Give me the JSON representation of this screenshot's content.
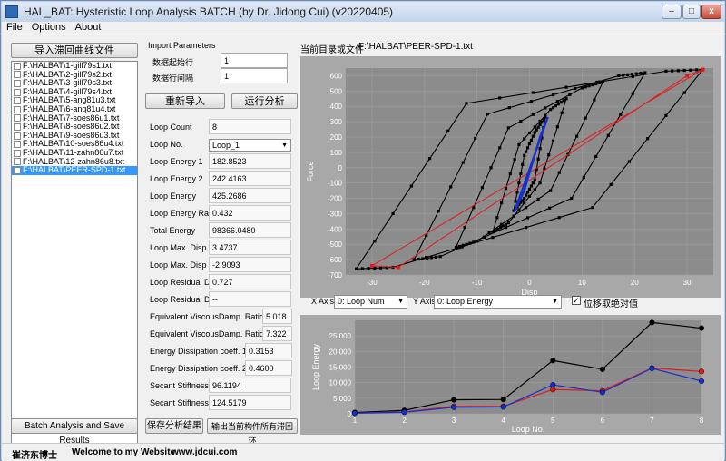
{
  "window": {
    "title": "HAL_BAT: Hysteristic Loop Analysis BATCH (by Dr. Jidong Cui) (v20220405)",
    "min": "–",
    "max": "□",
    "close": "x"
  },
  "menu": [
    "File",
    "Options",
    "About"
  ],
  "left": {
    "import_button": "导入滞回曲线文件",
    "files": [
      "F:\\HALBAT\\1-gill79s1.txt",
      "F:\\HALBAT\\2-gill79s2.txt",
      "F:\\HALBAT\\3-gill79s3.txt",
      "F:\\HALBAT\\4-gill79s4.txt",
      "F:\\HALBAT\\5-ang81u3.txt",
      "F:\\HALBAT\\6-ang81u4.txt",
      "F:\\HALBAT\\7-soes86u1.txt",
      "F:\\HALBAT\\8-soes86u2.txt",
      "F:\\HALBAT\\9-soes86u3.txt",
      "F:\\HALBAT\\10-soes86u4.txt",
      "F:\\HALBAT\\11-zahn86u7.txt",
      "F:\\HALBAT\\12-zahn86u8.txt",
      "F:\\HALBAT\\PEER-SPD-1.txt"
    ],
    "batch_button": "Batch Analysis and Save Results"
  },
  "params": {
    "group_title": "Import Parameters",
    "start_row_label": "数据起始行",
    "start_row": "1",
    "row_interval_label": "数据行间隔",
    "row_interval": "1",
    "reimport_button": "重新导入",
    "run_button": "运行分析"
  },
  "results": [
    {
      "label": "Loop Count",
      "value": "8"
    },
    {
      "label": "Loop No.",
      "value": "Loop_1"
    },
    {
      "label": "Loop Energy 1",
      "value": "182.8523"
    },
    {
      "label": "Loop Energy 2",
      "value": "242.4163"
    },
    {
      "label": "Loop Energy",
      "value": "425.2686"
    },
    {
      "label": "Loop Energy Ratio (%)",
      "value": "0.432"
    },
    {
      "label": "Total Energy",
      "value": "98366.0480"
    },
    {
      "label": "Loop Max. Disp 1",
      "value": "3.4737"
    },
    {
      "label": "Loop Max. Disp 2",
      "value": "-2.9093"
    },
    {
      "label": "Loop Residual Disp1",
      "value": "0.727"
    },
    {
      "label": "Loop Residual Disp2",
      "value": "--"
    },
    {
      "label": "Equivalent ViscousDamp. Ratio1 (%)",
      "value": "5.018"
    },
    {
      "label": "Equivalent ViscousDamp. Ratio2 (%)",
      "value": "7.322"
    },
    {
      "label": "Energy Dissipation coeff. 1",
      "value": "0.3153"
    },
    {
      "label": "Energy Dissipation coeff. 2",
      "value": "0.4600"
    },
    {
      "label": "Secant Stiffness 1",
      "value": "96.1194"
    },
    {
      "label": "Secant Stiffness 2",
      "value": "124.5179"
    }
  ],
  "save_button": "保存分析结果",
  "export_button": "输出当前构件所有滞回环",
  "current_file": {
    "label": "当前目录或文件",
    "value": "F:\\HALBAT\\PEER-SPD-1.txt"
  },
  "axis_controls": {
    "x_label": "X Axis",
    "x_value": "0: Loop Num",
    "y_label": "Y Axis",
    "y_value": "0: Loop Energy",
    "abs_label": "位移取绝对值",
    "abs_checked": true
  },
  "colors": {
    "plot_bg": "#8c8c8c",
    "plot_outer": "#a8a8a8",
    "black": "#000000",
    "red": "#e01b1b",
    "blue": "#1530d0"
  },
  "chart_data": [
    {
      "type": "scatter",
      "title": "",
      "xlabel": "Disp",
      "ylabel": "Force",
      "xlim": [
        -35,
        35
      ],
      "ylim": [
        -700,
        650
      ],
      "xticks": [
        -30,
        -20,
        -10,
        0,
        10,
        20,
        30
      ],
      "yticks": [
        -700,
        -600,
        -500,
        -400,
        -300,
        -200,
        -100,
        0,
        100,
        200,
        300,
        400,
        500,
        600
      ],
      "series": [
        {
          "color": "black",
          "kind": "points",
          "loops": [
            [
              3,
              330,
              1,
              230,
              -1,
              80,
              -3,
              -280,
              -1,
              -200,
              1,
              -80
            ],
            [
              7,
              450,
              4,
              380,
              -2,
              150,
              -7,
              -420,
              -4,
              -360,
              2,
              -100
            ],
            [
              14,
              560,
              10,
              520,
              -4,
              260,
              -14,
              -520,
              -10,
              -480,
              4,
              -150
            ],
            [
              22,
              620,
              17,
              600,
              -8,
              350,
              -22,
              -600,
              -17,
              -580,
              8,
              -200
            ],
            [
              33,
              640,
              26,
              630,
              -12,
              420,
              -33,
              -660,
              -26,
              -650,
              12,
              -260
            ]
          ]
        },
        {
          "color": "red",
          "kind": "line",
          "points": [
            [
              33,
              640
            ],
            [
              -30,
              -640
            ],
            [
              -25,
              -650
            ],
            [
              30,
              600
            ],
            [
              33,
              640
            ]
          ]
        },
        {
          "color": "blue",
          "kind": "line",
          "points": [
            [
              3.5,
              330
            ],
            [
              -2.9,
              -290
            ],
            [
              -1,
              -150
            ],
            [
              2,
              200
            ],
            [
              3.5,
              330
            ]
          ]
        }
      ]
    },
    {
      "type": "line",
      "title": "",
      "xlabel": "Loop No.",
      "ylabel": "Loop Energy",
      "xlim": [
        1,
        8
      ],
      "ylim": [
        0,
        30000
      ],
      "x": [
        1,
        2,
        3,
        4,
        5,
        6,
        7,
        8
      ],
      "yticks": [
        0,
        5000,
        10000,
        15000,
        20000,
        25000
      ],
      "series": [
        {
          "color": "black",
          "values": [
            425,
            1100,
            4500,
            4600,
            17100,
            14300,
            29300,
            27500
          ]
        },
        {
          "color": "red",
          "values": [
            240,
            600,
            2400,
            2400,
            7800,
            7400,
            14700,
            13600
          ]
        },
        {
          "color": "blue",
          "values": [
            182,
            500,
            2100,
            2200,
            9300,
            6900,
            14600,
            10500
          ]
        }
      ]
    }
  ],
  "status": {
    "author": "崔济东博士",
    "welcome": "Welcome to my Website",
    "site": "www.jdcui.com"
  }
}
